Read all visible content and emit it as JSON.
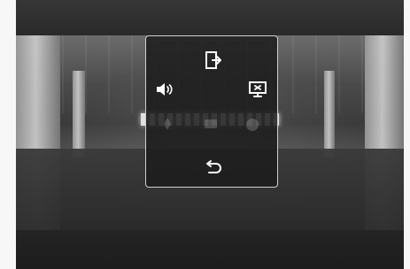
{
  "player": {
    "top_bar": {},
    "bottom_bar": {}
  },
  "overlay": {
    "controls": [
      {
        "name": "exit-icon",
        "icon": "exit"
      },
      {
        "name": "volume-icon",
        "icon": "speaker"
      },
      {
        "name": "display-icon",
        "icon": "display"
      },
      {
        "name": "back-icon",
        "icon": "return"
      }
    ],
    "colors": {
      "panel_border": "#cfcfcf",
      "panel_fill": "#1c1c1c",
      "icon": "#ffffff"
    }
  }
}
